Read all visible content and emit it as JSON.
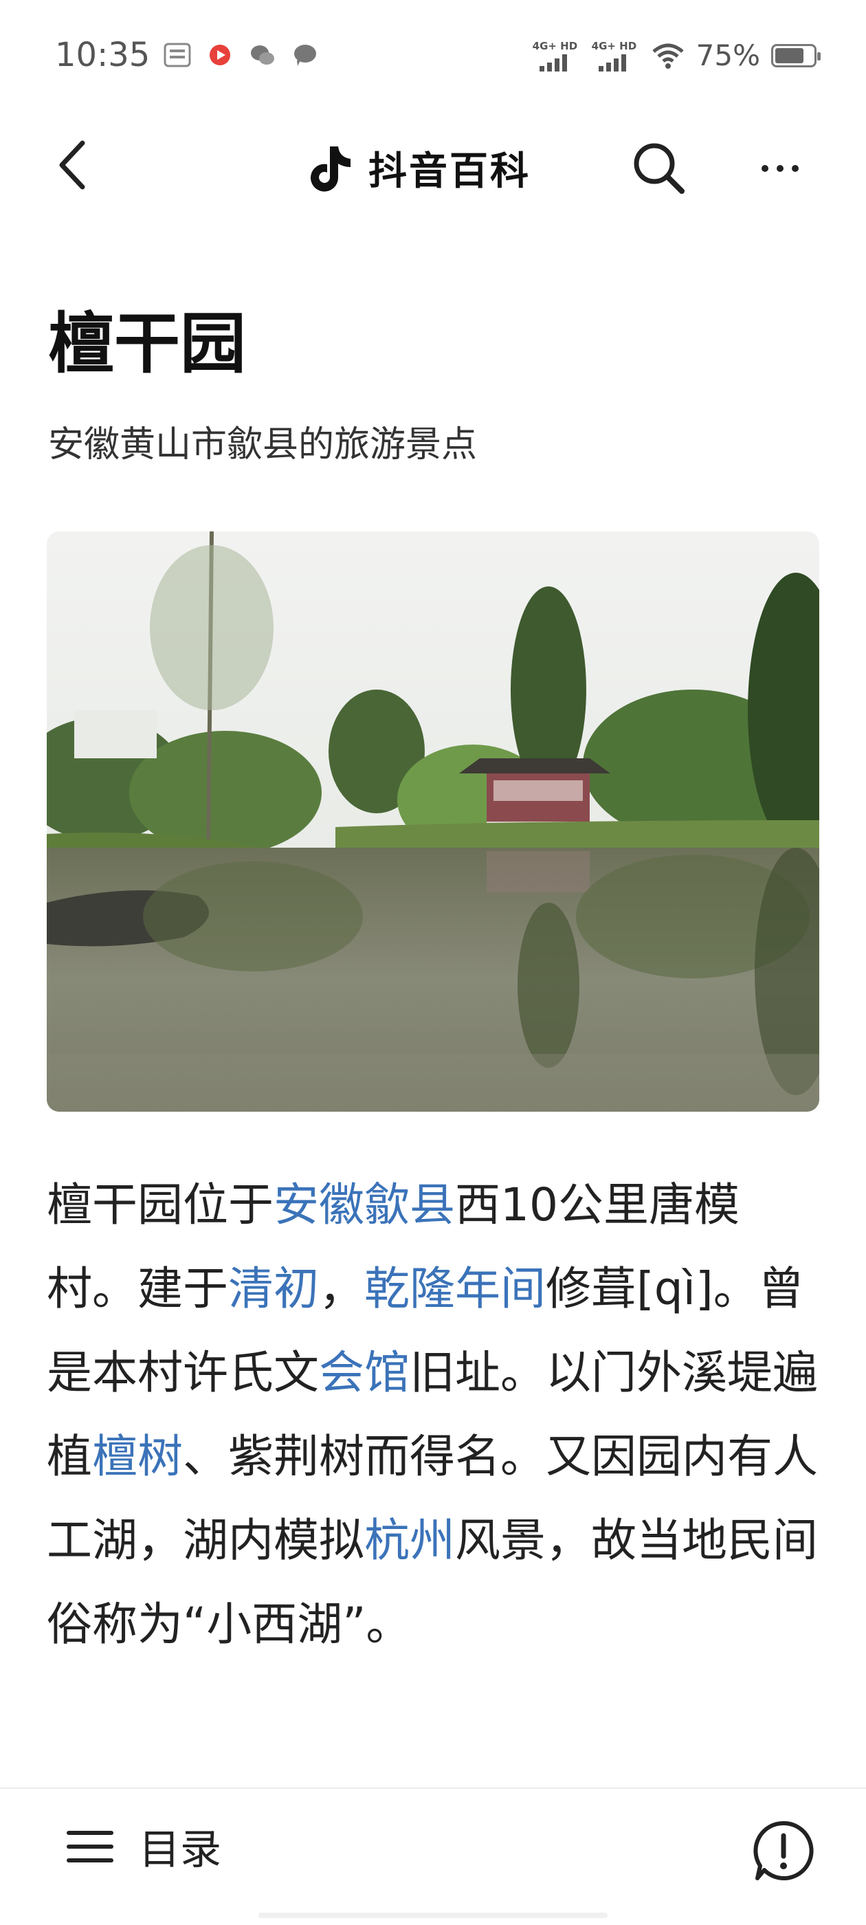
{
  "status_bar": {
    "time": "10:35",
    "notification_icons": [
      "toutiao-icon",
      "video-app-icon",
      "wechat-icon",
      "message-icon"
    ],
    "network_1": "4G+ HD",
    "network_2": "4G+ HD",
    "battery_percent": "75%",
    "battery_level": 0.75
  },
  "header": {
    "brand_title": "抖音百科",
    "back_icon": "chevron-left-icon",
    "search_icon": "search-icon",
    "more_icon": "more-horizontal-icon"
  },
  "entry": {
    "title": "檀干园",
    "subtitle": "安徽黄山市歙县的旅游景点",
    "image_icon": "garden-pond-photo"
  },
  "article": {
    "t1": "檀干园位于",
    "l1": "安徽歙县",
    "t2": "西10公里唐模村。建于",
    "l2": "清初",
    "t3": "，",
    "l3": "乾隆年间",
    "t4": "修葺[qì]。曾是本村许氏文",
    "l4": "会馆",
    "t5": "旧址。以门外溪堤遍植",
    "l5": "檀树",
    "t6": "、紫荆树而得名。又因园内有人工湖，湖内模拟",
    "l6": "杭州",
    "t7": "风景，故当地民间俗称为“小西湖”。"
  },
  "bottom_bar": {
    "toc_label": "目录",
    "toc_icon": "menu-icon",
    "report_icon": "exclamation-circle-icon"
  },
  "colors": {
    "link": "#3b73b9",
    "text": "#222222",
    "background": "#ffffff"
  }
}
